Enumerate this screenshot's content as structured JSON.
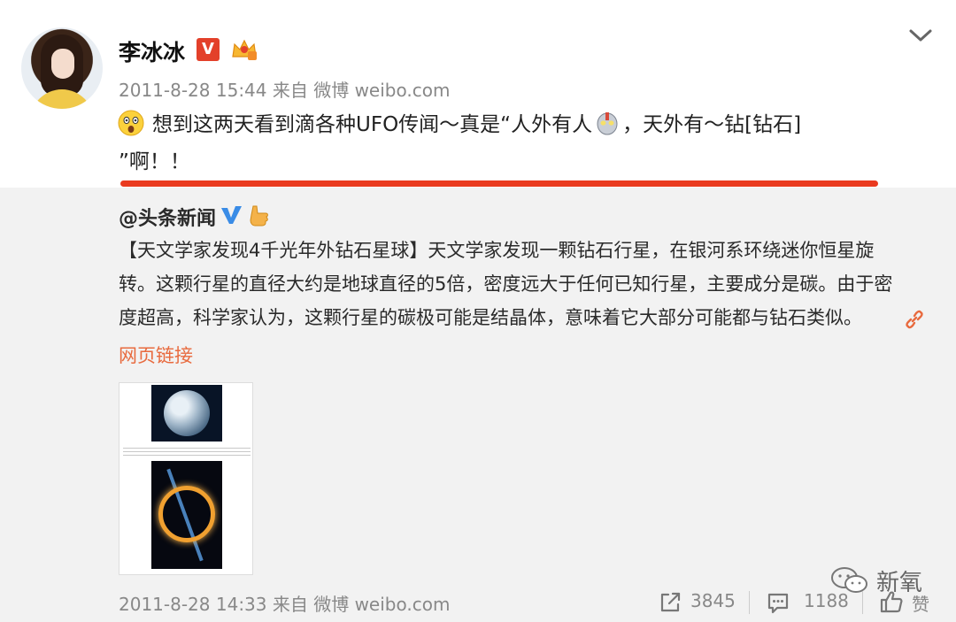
{
  "post": {
    "username": "李冰冰",
    "vip_badge": "V",
    "timestamp": "2011-8-28 15:44",
    "source_prefix": "来自",
    "source": "微博 weibo.com",
    "text_line1_a": "想到这两天看到滴各种UFO传闻～真是“人外有人",
    "text_line1_b": "，天外有～钻[钻石]",
    "text_line2": "”啊！！",
    "emoji_icons": [
      "surprised-emoji",
      "robot-emoji"
    ],
    "underline_color": "#ea3a1f"
  },
  "repost": {
    "author": "@头条新闻",
    "body_lines": [
      "【天文学家发现4千光年外钻石星球】天文学家发现一颗钻石行星，在银河系环绕迷你恒星旋",
      "转。这颗行星的直径大约是地球直径的5倍，密度远大于任何已知行星，主要成分是碳。由于密",
      "度超高，科学家认为，这颗行星的碳极可能是结晶体，意味着它大部分可能都与钻石类似。"
    ],
    "web_link": "网页链接",
    "link_color": "#e86a3e",
    "timestamp": "2011-8-28 14:33",
    "source_prefix": "来自",
    "source": "微博 weibo.com",
    "share_count": "3845",
    "comment_count": "1188",
    "like_label": "赞"
  },
  "watermark": {
    "text": "新氧"
  },
  "colors": {
    "repost_bg": "#f2f2f2",
    "meta_text": "#888888",
    "vip_red": "#e3402a",
    "verified_blue": "#3a8ce6"
  }
}
